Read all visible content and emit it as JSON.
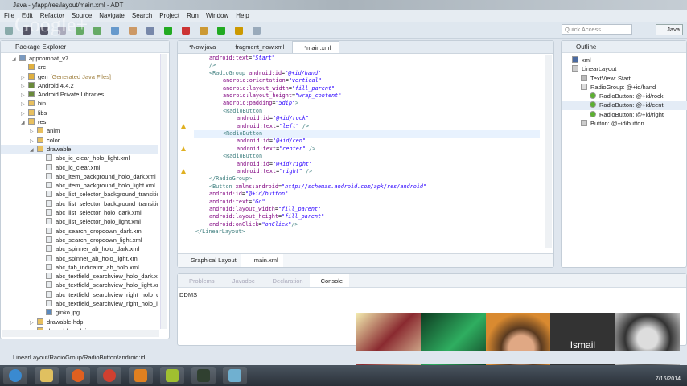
{
  "window": {
    "title": "Java - yfapp/res/layout/main.xml - ADT"
  },
  "menu": [
    "File",
    "Edit",
    "Refactor",
    "Source",
    "Navigate",
    "Search",
    "Project",
    "Run",
    "Window",
    "Help"
  ],
  "toolbar": {
    "quick_access_placeholder": "Quick Access",
    "perspective": "Java"
  },
  "package_explorer": {
    "title": "Package Explorer",
    "items": [
      {
        "label": "appcompat_v7",
        "level": 0,
        "icon": "project-icon",
        "exp": "open"
      },
      {
        "label": "src",
        "level": 1,
        "icon": "package-folder-icon"
      },
      {
        "label": "gen",
        "suffix": "[Generated Java Files]",
        "level": 1,
        "icon": "package-folder-icon",
        "exp": "closed"
      },
      {
        "label": "Android 4.4.2",
        "level": 1,
        "icon": "library-icon",
        "exp": "closed"
      },
      {
        "label": "Android Private Libraries",
        "level": 1,
        "icon": "library-icon",
        "exp": "closed"
      },
      {
        "label": "bin",
        "level": 1,
        "icon": "folder-icon",
        "exp": "closed"
      },
      {
        "label": "libs",
        "level": 1,
        "icon": "folder-icon",
        "exp": "closed"
      },
      {
        "label": "res",
        "level": 1,
        "icon": "folder-icon",
        "exp": "open"
      },
      {
        "label": "anim",
        "level": 2,
        "icon": "folder-icon",
        "exp": "closed"
      },
      {
        "label": "color",
        "level": 2,
        "icon": "folder-icon",
        "exp": "closed"
      },
      {
        "label": "drawable",
        "level": 2,
        "icon": "folder-icon",
        "exp": "open",
        "selected": true
      },
      {
        "label": "abc_ic_clear_holo_light.xml",
        "level": 3,
        "icon": "xml-file-icon"
      },
      {
        "label": "abc_ic_clear.xml",
        "level": 3,
        "icon": "xml-file-icon"
      },
      {
        "label": "abc_item_background_holo_dark.xml",
        "level": 3,
        "icon": "xml-file-icon"
      },
      {
        "label": "abc_item_background_holo_light.xml",
        "level": 3,
        "icon": "xml-file-icon"
      },
      {
        "label": "abc_list_selector_background_transitio",
        "level": 3,
        "icon": "xml-file-icon"
      },
      {
        "label": "abc_list_selector_background_transitio",
        "level": 3,
        "icon": "xml-file-icon"
      },
      {
        "label": "abc_list_selector_holo_dark.xml",
        "level": 3,
        "icon": "xml-file-icon"
      },
      {
        "label": "abc_list_selector_holo_light.xml",
        "level": 3,
        "icon": "xml-file-icon"
      },
      {
        "label": "abc_search_dropdown_dark.xml",
        "level": 3,
        "icon": "xml-file-icon"
      },
      {
        "label": "abc_search_dropdown_light.xml",
        "level": 3,
        "icon": "xml-file-icon"
      },
      {
        "label": "abc_spinner_ab_holo_dark.xml",
        "level": 3,
        "icon": "xml-file-icon"
      },
      {
        "label": "abc_spinner_ab_holo_light.xml",
        "level": 3,
        "icon": "xml-file-icon"
      },
      {
        "label": "abc_tab_indicator_ab_holo.xml",
        "level": 3,
        "icon": "xml-file-icon"
      },
      {
        "label": "abc_textfield_searchview_holo_dark.xm",
        "level": 3,
        "icon": "xml-file-icon"
      },
      {
        "label": "abc_textfield_searchview_holo_light.xm",
        "level": 3,
        "icon": "xml-file-icon"
      },
      {
        "label": "abc_textfield_searchview_right_holo_da",
        "level": 3,
        "icon": "xml-file-icon"
      },
      {
        "label": "abc_textfield_searchview_right_holo_lig",
        "level": 3,
        "icon": "xml-file-icon"
      },
      {
        "label": "ginko.jpg",
        "level": 3,
        "icon": "image-file-icon"
      },
      {
        "label": "drawable-hdpi",
        "level": 2,
        "icon": "folder-icon",
        "exp": "closed"
      },
      {
        "label": "drawable-mdpi",
        "level": 2,
        "icon": "folder-icon",
        "exp": "closed"
      }
    ]
  },
  "editor": {
    "tabs": [
      {
        "label": "*Now.java"
      },
      {
        "label": "fragment_now.xml"
      },
      {
        "label": "*main.xml",
        "active": true
      }
    ],
    "bottom_tabs": [
      "Graphical Layout",
      "main.xml"
    ],
    "current_line": 10,
    "lines": [
      [
        2,
        [
          [
            "att",
            "android:text"
          ],
          [
            "pun",
            "="
          ],
          [
            "val",
            "\"Start\""
          ]
        ]
      ],
      [
        2,
        [
          [
            "tag",
            "/>"
          ]
        ]
      ],
      [
        2,
        [
          [
            "tag",
            "<RadioGroup "
          ],
          [
            "att",
            "android:id"
          ],
          [
            "pun",
            "="
          ],
          [
            "val",
            "\"@+id/hand\""
          ]
        ]
      ],
      [
        4,
        [
          [
            "att",
            "android:orientation"
          ],
          [
            "pun",
            "="
          ],
          [
            "val",
            "\"vertical\""
          ]
        ]
      ],
      [
        4,
        [
          [
            "att",
            "android:layout_width"
          ],
          [
            "pun",
            "="
          ],
          [
            "val",
            "\"fill_parent\""
          ]
        ]
      ],
      [
        4,
        [
          [
            "att",
            "android:layout_height"
          ],
          [
            "pun",
            "="
          ],
          [
            "val",
            "\"wrap_content\""
          ]
        ]
      ],
      [
        4,
        [
          [
            "att",
            "android:padding"
          ],
          [
            "pun",
            "="
          ],
          [
            "val",
            "\"5dip\""
          ],
          [
            "tag",
            ">"
          ]
        ]
      ],
      [
        4,
        [
          [
            "tag",
            "<RadioButton"
          ]
        ]
      ],
      [
        6,
        [
          [
            "att",
            "android:id"
          ],
          [
            "pun",
            "="
          ],
          [
            "val",
            "\"@+id/rock\""
          ]
        ]
      ],
      [
        6,
        [
          [
            "att",
            "android:text"
          ],
          [
            "pun",
            "="
          ],
          [
            "val",
            "\"left\""
          ],
          [
            "tag",
            " />"
          ]
        ]
      ],
      [
        4,
        [
          [
            "tag",
            "<RadioButton"
          ]
        ]
      ],
      [
        6,
        [
          [
            "att",
            "android:id"
          ],
          [
            "pun",
            "="
          ],
          [
            "val",
            "\"@+id/cen\""
          ]
        ]
      ],
      [
        6,
        [
          [
            "att",
            "android:text"
          ],
          [
            "pun",
            "="
          ],
          [
            "val",
            "\"center\""
          ],
          [
            "tag",
            " />"
          ]
        ]
      ],
      [
        4,
        [
          [
            "tag",
            "<RadioButton"
          ]
        ]
      ],
      [
        6,
        [
          [
            "att",
            "android:id"
          ],
          [
            "pun",
            "="
          ],
          [
            "val",
            "\"@+id/right\""
          ]
        ]
      ],
      [
        6,
        [
          [
            "att",
            "android:text"
          ],
          [
            "pun",
            "="
          ],
          [
            "val",
            "\"right\""
          ],
          [
            "tag",
            " />"
          ]
        ]
      ],
      [
        2,
        [
          [
            "tag",
            "</RadioGroup>"
          ]
        ]
      ],
      [
        2,
        [
          [
            "tag",
            "<Button "
          ],
          [
            "att",
            "xmlns:android"
          ],
          [
            "pun",
            "="
          ],
          [
            "val",
            "\"http://schemas.android.com/apk/res/android\""
          ]
        ]
      ],
      [
        2,
        [
          [
            "att",
            "android:id"
          ],
          [
            "pun",
            "="
          ],
          [
            "val",
            "\"@+id/button\""
          ]
        ]
      ],
      [
        2,
        [
          [
            "att",
            "android:text"
          ],
          [
            "pun",
            "="
          ],
          [
            "val",
            "\"Go\""
          ]
        ]
      ],
      [
        2,
        [
          [
            "att",
            "android:layout_width"
          ],
          [
            "pun",
            "="
          ],
          [
            "val",
            "\"fill_parent\""
          ]
        ]
      ],
      [
        2,
        [
          [
            "att",
            "android:layout_height"
          ],
          [
            "pun",
            "="
          ],
          [
            "val",
            "\"fill_parent\""
          ]
        ]
      ],
      [
        2,
        [
          [
            "att",
            "android:onClick"
          ],
          [
            "pun",
            "="
          ],
          [
            "val",
            "\"onClick\""
          ],
          [
            "tag",
            "/>"
          ]
        ]
      ],
      [
        0,
        [
          [
            "tag",
            "</LinearLayout>"
          ]
        ]
      ]
    ]
  },
  "outline": {
    "title": "Outline",
    "items": [
      {
        "label": "xml",
        "level": 0,
        "icon": "xml-decl-icon"
      },
      {
        "label": "LinearLayout",
        "level": 0,
        "icon": "linear-layout-icon"
      },
      {
        "label": "TextView: Start",
        "level": 1,
        "icon": "textview-icon"
      },
      {
        "label": "RadioGroup: @+id/hand",
        "level": 1,
        "icon": "radiogroup-icon"
      },
      {
        "label": "RadioButton: @+id/rock",
        "level": 2,
        "icon": "radio-button-icon"
      },
      {
        "label": "RadioButton: @+id/cent",
        "level": 2,
        "icon": "radio-button-icon",
        "selected": true
      },
      {
        "label": "RadioButton: @+id/right",
        "level": 2,
        "icon": "radio-button-icon"
      },
      {
        "label": "Button: @+id/button",
        "level": 1,
        "icon": "button-icon"
      }
    ]
  },
  "console": {
    "tabs": [
      "Problems",
      "Javadoc",
      "Declaration",
      "Console"
    ],
    "active": "Console",
    "content": "DDMS"
  },
  "status": {
    "path": "LinearLayout/RadioGroup/RadioButton/android:id"
  },
  "hangout": {
    "participant_name": "Ismail",
    "watermark": "Google+"
  },
  "taskbar": {
    "date": "7/16/2014",
    "apps": [
      "start-orb-icon",
      "explorer-icon",
      "firefox-icon",
      "chrome-icon",
      "pdf-icon",
      "eclipse-icon",
      "android-icon",
      "notepad-icon"
    ]
  }
}
